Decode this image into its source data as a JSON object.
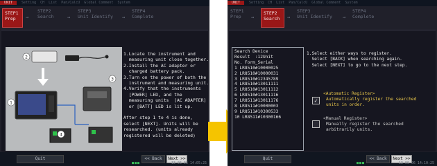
{
  "screens": {
    "step1": {
      "topbar": [
        "UNIT",
        "Setting",
        "CH",
        "List",
        "Pan/CalcU",
        "Global Comment",
        "System"
      ],
      "steps": [
        {
          "num": "STEP1",
          "name": "Prep",
          "active": true
        },
        {
          "num": "STEP2",
          "name": "Search",
          "active": false
        },
        {
          "num": "STEP3",
          "name": "Unit Identify",
          "active": false
        },
        {
          "num": "STEP4",
          "name": "Complete",
          "active": false
        }
      ],
      "callouts": [
        "1",
        "2",
        "3",
        "4"
      ],
      "instructions": "1.Locate the instrument and\n  measuring unit close together.\n2.Install the AC adapter or\n  charged battery pack.\n3.Turn on the power of both the\n  instrument and measuring unit.\n4.Verify that the instruments\n  [POWER] LED, and the\n  measuring units  [AC ADAPTER]\n  or [BATT] LED is lit up.\n\nAfter step 1 to 4 is done,\nselect [NEXT]. Units will be\nresearched. (units already\nregistered will be deleted)",
      "bottom": {
        "quit": "Quit",
        "back": "<< Back",
        "next": "Next >>",
        "clock": "13-06-06 14:05:25"
      }
    },
    "step2": {
      "topbar": [
        "UNIT",
        "Setting",
        "CH",
        "List",
        "Pan/CalcU",
        "Global Comment",
        "System"
      ],
      "steps": [
        {
          "num": "STEP1",
          "name": "Prep",
          "active": false
        },
        {
          "num": "STEP2",
          "name": "Search",
          "active": true
        },
        {
          "num": "STEP3",
          "name": "Unit Identify",
          "active": false
        },
        {
          "num": "STEP4",
          "name": "Complete",
          "active": false
        }
      ],
      "search_device": {
        "title": "Search Device",
        "result_label": "Result",
        "result_value": ":12Unit",
        "header": "No. Form_Serial",
        "rows": [
          "1  LR8510#10000025",
          "2  LR8510#10000031",
          "3  LR8510#12345789",
          "4  LR8510#13011111",
          "5  LR8510#13011112",
          "6  LR8510#13011116",
          "7  LR8511#13011176",
          "8  LR8511#10000003",
          "9  LR8511#10300533",
          "10 LR8511#10300166"
        ]
      },
      "description": "1.Select either ways to register.\n  Select [BACK] when searching again.\n  Select [NEXT] to go to the next step.",
      "auto_register": {
        "title": "<Automatic Register>",
        "text": "Automatically register the searched\nunits in order.",
        "checked": true
      },
      "manual_register": {
        "title": "<Manual Register>",
        "text": "Manually register the searched\narbitrarily units.",
        "checked": false
      },
      "bottom": {
        "quit": "Quit",
        "back": "<< Back",
        "next": "Next >>",
        "clock": "13-06-06 14:10:25"
      }
    }
  },
  "colors": {
    "accent_step": "#9a1717",
    "arrow": "#f5c400",
    "auto_text": "#e6c44a"
  }
}
